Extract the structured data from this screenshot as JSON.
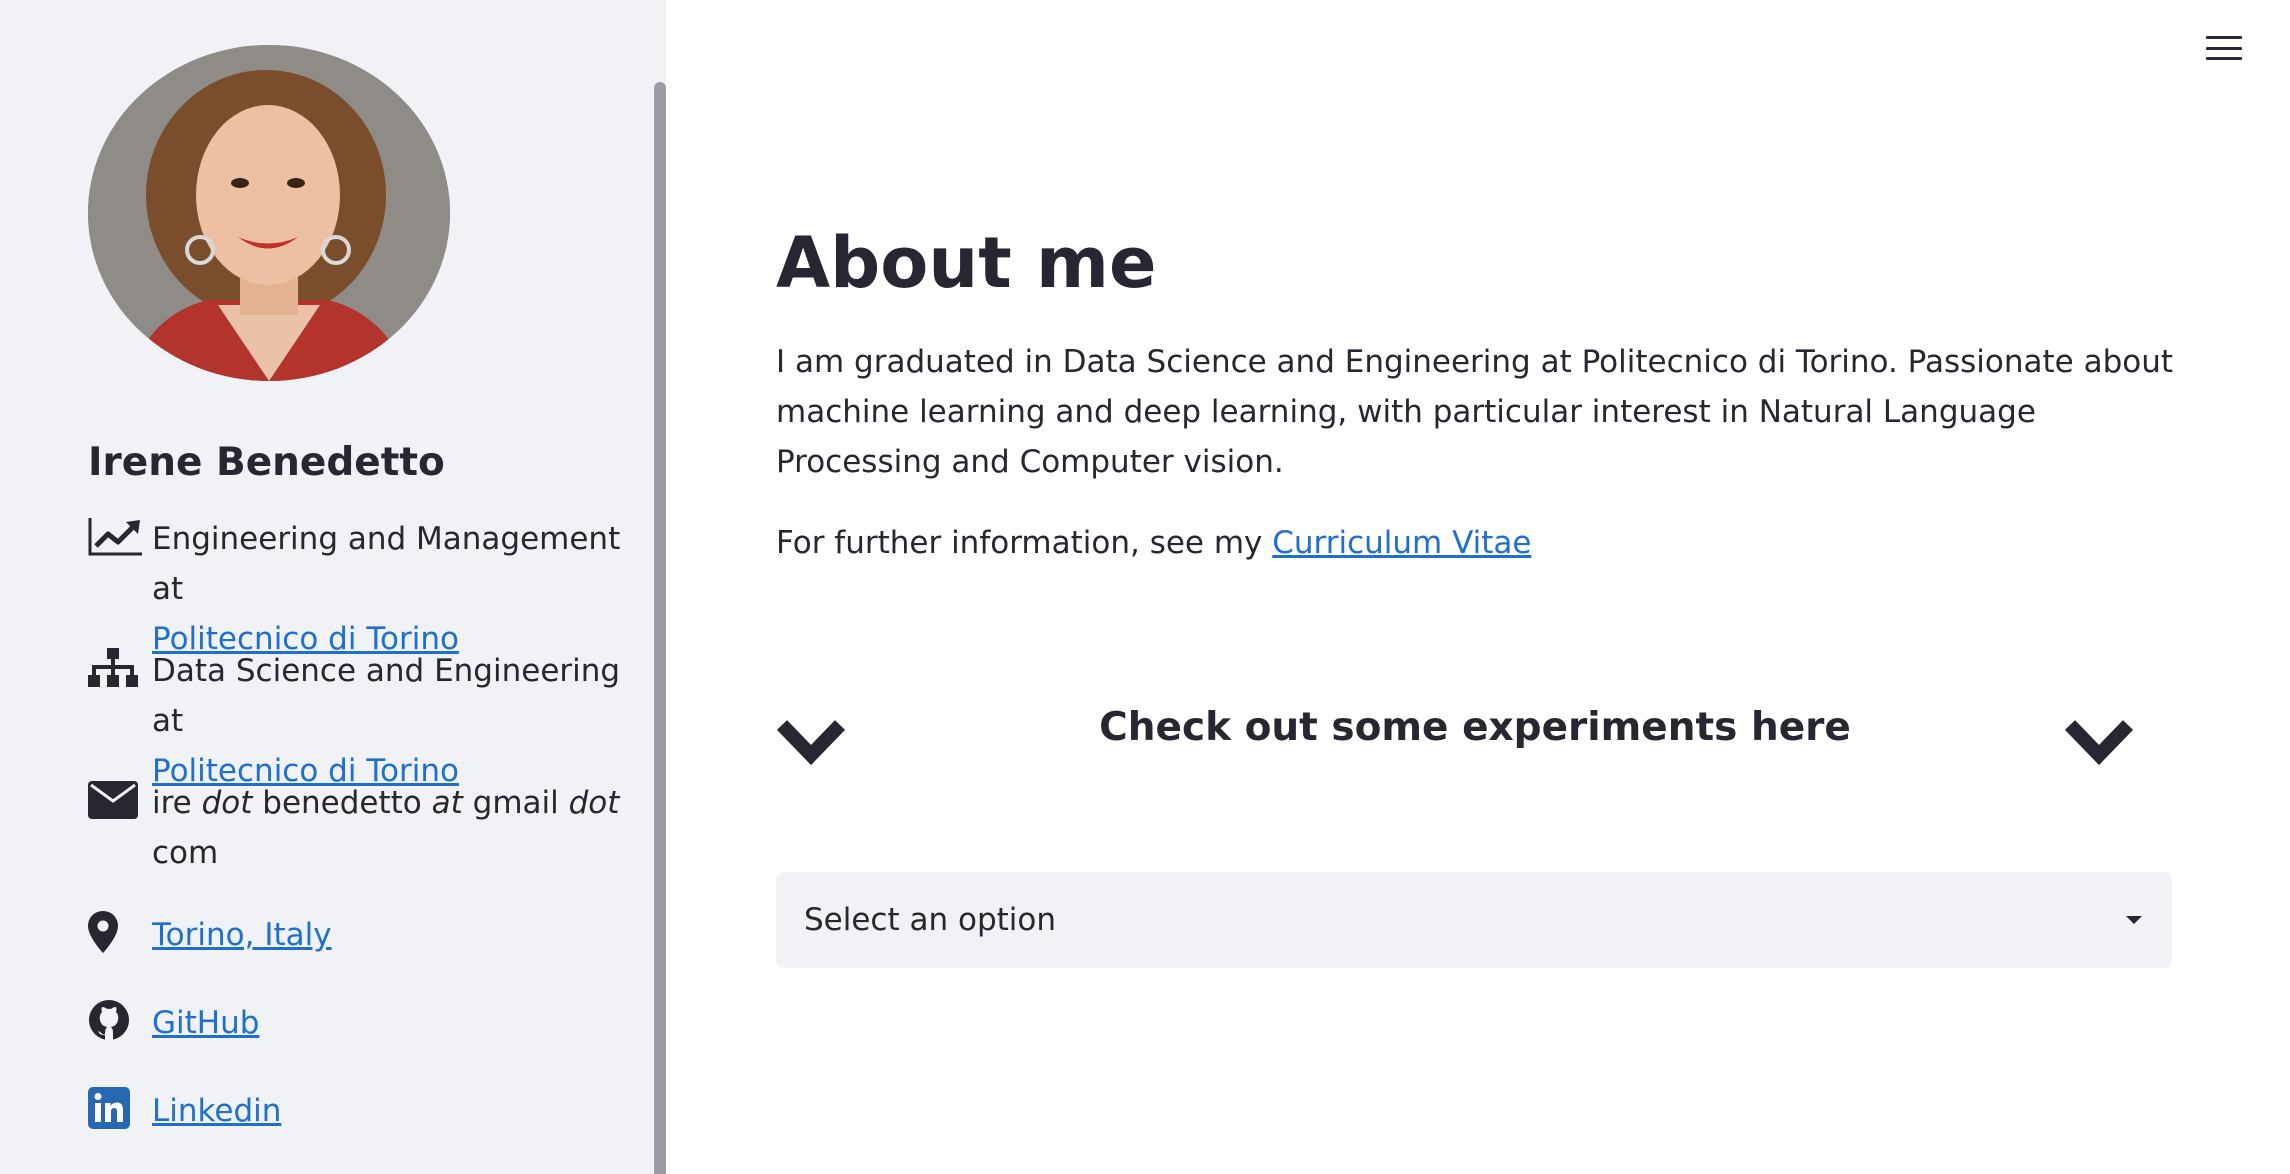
{
  "sidebar": {
    "profile_name": "Irene Benedetto",
    "items": [
      {
        "icon": "chart-line-icon",
        "text": "Engineering and Management at",
        "link": "Politecnico di Torino"
      },
      {
        "icon": "sitemap-icon",
        "text": "Data Science and Engineering at",
        "link": "Politecnico di Torino"
      },
      {
        "icon": "envelope-icon",
        "parts": [
          "ire ",
          "dot",
          " benedetto ",
          "at",
          " gmail ",
          "dot",
          " com"
        ]
      },
      {
        "icon": "map-marker-icon",
        "link": "Torino, Italy"
      },
      {
        "icon": "github-icon",
        "link": "GitHub"
      },
      {
        "icon": "linkedin-icon",
        "link": "Linkedin"
      }
    ]
  },
  "main": {
    "title": "About me",
    "about": "I am graduated in Data Science and Engineering at Politecnico di Torino. Passionate about machine learning and deep learning, with particular interest in Natural Language Processing and Computer vision.",
    "cv_prefix": "For further information, see my ",
    "cv_link": "Curriculum Vitae",
    "experiments_heading": "Check out some experiments here",
    "select": {
      "value": "Select an option"
    }
  },
  "colors": {
    "sidebar_bg": "#f0f2f6",
    "text": "#262730",
    "link": "#1f6fcf",
    "linkedin": "#2867b2"
  }
}
